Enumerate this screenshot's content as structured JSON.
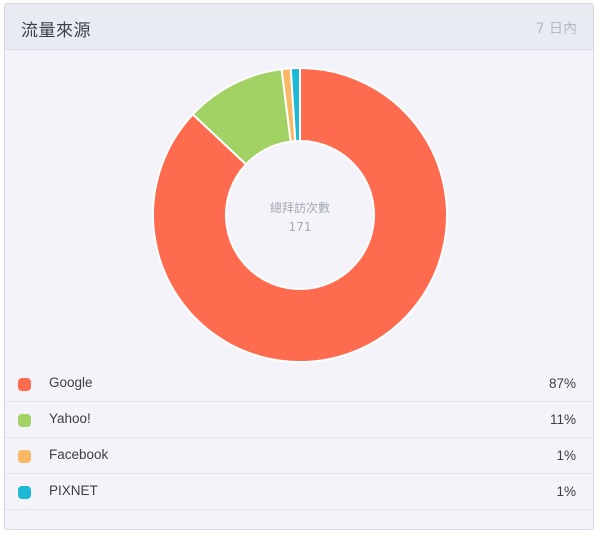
{
  "header": {
    "title": "流量來源",
    "period": "7 日內"
  },
  "donut": {
    "center_title": "總拜訪次數",
    "center_value": "171"
  },
  "chart_data": {
    "type": "pie",
    "title": "",
    "total": 171,
    "slices": [
      {
        "name": "Google",
        "value": 87,
        "label": "87%",
        "color": "#fe6b4e"
      },
      {
        "name": "Yahoo!",
        "value": 11,
        "label": "11%",
        "color": "#a2d264"
      },
      {
        "name": "Facebook",
        "value": 1,
        "label": "1%",
        "color": "#f8b866"
      },
      {
        "name": "PIXNET",
        "value": 1,
        "label": "1%",
        "color": "#1cb8d5"
      }
    ]
  }
}
